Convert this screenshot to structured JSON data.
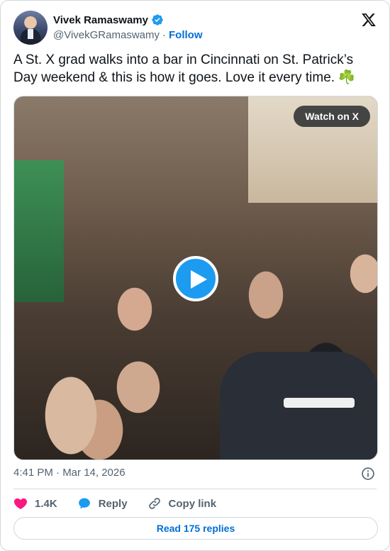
{
  "author": {
    "name": "Vivek Ramaswamy",
    "handle": "@VivekGRamaswamy",
    "separator": "·",
    "follow_label": "Follow"
  },
  "tweet": {
    "text": "A St. X grad walks into a bar in Cincinnati on St. Patrick’s Day weekend & this is how it goes. Love it every time. ☘️",
    "timestamp": "4:41 PM · Mar 14, 2026"
  },
  "media": {
    "watch_label": "Watch on X",
    "play_icon": "play-icon"
  },
  "actions": {
    "likes": "1.4K",
    "reply_label": "Reply",
    "copy_label": "Copy link"
  },
  "footer": {
    "read_replies_label": "Read 175 replies"
  },
  "colors": {
    "accent": "#1d9bf0",
    "link": "#006fd6",
    "like": "#f91880",
    "muted": "#536471",
    "text": "#0f1419"
  }
}
